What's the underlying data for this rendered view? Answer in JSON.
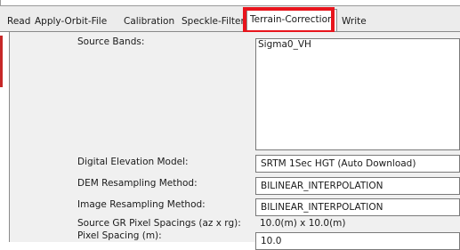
{
  "tabs": [
    {
      "label": "Read",
      "selected": false
    },
    {
      "label": "Apply-Orbit-File",
      "selected": false
    },
    {
      "label": "Calibration",
      "selected": false
    },
    {
      "label": "Speckle-Filter",
      "selected": false
    },
    {
      "label": "Terrain-Correction",
      "selected": true
    },
    {
      "label": "Write",
      "selected": false
    }
  ],
  "colors": {
    "highlight": "#e8141c",
    "panel_background": "#f0f0f0",
    "tabbar_background": "#ececec"
  },
  "form": {
    "source_bands": {
      "label": "Source Bands:",
      "items": [
        "Sigma0_VH"
      ]
    },
    "dem": {
      "label": "Digital Elevation Model:",
      "value": "SRTM 1Sec HGT (Auto Download)"
    },
    "dem_resampling": {
      "label": "DEM Resampling Method:",
      "value": "BILINEAR_INTERPOLATION"
    },
    "image_resampling": {
      "label": "Image Resampling Method:",
      "value": "BILINEAR_INTERPOLATION"
    },
    "source_gr_spacing": {
      "label": "Source GR Pixel Spacings (az x rg):",
      "value": "10.0(m) x 10.0(m)"
    },
    "pixel_spacing": {
      "label": "Pixel Spacing (m):",
      "value": "10.0"
    }
  }
}
